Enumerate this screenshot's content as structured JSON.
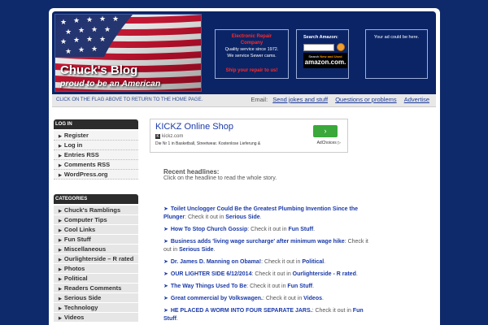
{
  "header": {
    "blog_title": "Chuck's Blog",
    "blog_subtitle": "proud to be an American",
    "repair": {
      "title_line1": "Electronic Repair",
      "title_line2": "Company",
      "line1": "Quality service since 1972.",
      "line2": "We service Sewer cams.",
      "cta": "Ship your repair to us!"
    },
    "amazon": {
      "label": "Search Amazon:",
      "input_value": "",
      "logo_line1": "Search",
      "logo_new": "New and Used",
      "logo_big": "amazon.com."
    },
    "ad_box": "Your ad could be here."
  },
  "navbar": {
    "home_text": "CLICK ON THE FLAG ABOVE TO RETURN TO THE HOME PAGE.",
    "email_label": "Email:",
    "link1": "Send jokes and stuff",
    "link2": "Questions or problems",
    "link3": "Advertise"
  },
  "sidebar": {
    "login_heading": "LOG IN",
    "login_items": [
      "Register",
      "Log in",
      "Entries RSS",
      "Comments RSS",
      "WordPress.org"
    ],
    "categories_heading": "CATEGORIES",
    "categories": [
      "Chuck's Ramblings",
      "Computer Tips",
      "Cool Links",
      "Fun Stuff",
      "Miscellaneous",
      "Ourlighterside – R rated",
      "Photos",
      "Political",
      "Readers Comments",
      "Serious Side",
      "Technology",
      "Videos"
    ]
  },
  "ad": {
    "title": "KICKZ Online Shop",
    "url": "kickz.com",
    "favicon": "K",
    "description": "Die Nr 1 in Basketball, Streetwear. Kostenlose Lieferung &",
    "arrow": "›",
    "choices": "AdChoices ▷"
  },
  "recent": {
    "title": "Recent headlines:",
    "subtitle": "Click on the headline to read the whole story.",
    "check_text": "Check it out in",
    "posts": [
      {
        "title": "Toilet Unclogger Could Be the Greatest Plumbing Invention Since the Plunger",
        "category": "Serious Side"
      },
      {
        "title": "How To Stop Church Gossip",
        "category": "Fun Stuff"
      },
      {
        "title": "Business adds 'living wage surcharge' after minimum wage hike",
        "category": "Serious Side"
      },
      {
        "title": "Dr. James D. Manning on Obama!",
        "category": "Political"
      },
      {
        "title": "OUR LIGHTER SIDE 6/12/2014",
        "category": "Ourlighterside - R rated"
      },
      {
        "title": "The Way Things Used To Be",
        "category": "Fun Stuff"
      },
      {
        "title": "Great commercial by Volkswagen.",
        "category": "Videos"
      },
      {
        "title": "HE PLACED A WORM INTO FOUR SEPARATE JARS.",
        "category": "Fun Stuff"
      }
    ]
  },
  "colors": {
    "page_bg": "#0f2a6b",
    "header_bg": "#0a2466",
    "link": "#1a3aa8",
    "sidebar_head": "#2c2c2c"
  }
}
